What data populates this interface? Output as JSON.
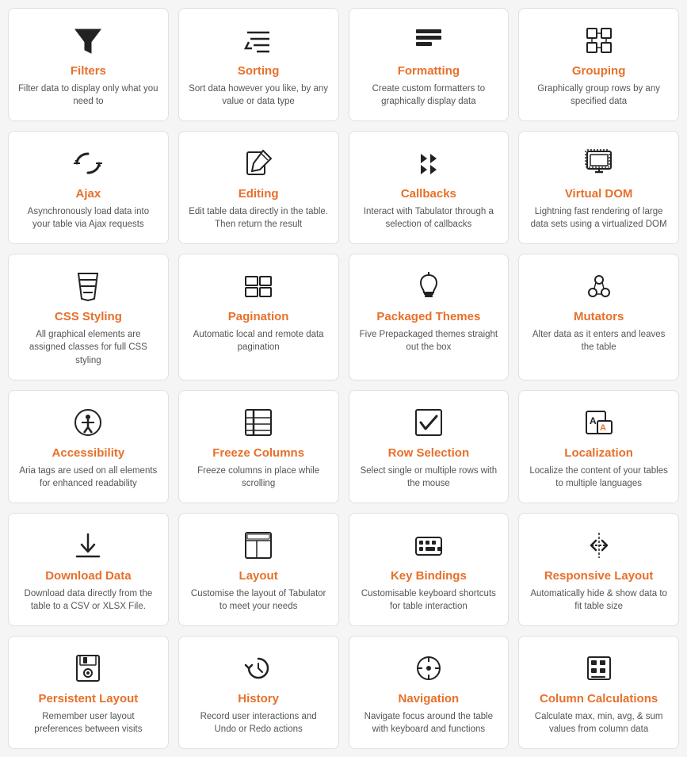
{
  "cards": [
    {
      "id": "filters",
      "icon": "filter",
      "title": "Filters",
      "desc": "Filter data to display only what you need to"
    },
    {
      "id": "sorting",
      "icon": "sort",
      "title": "Sorting",
      "desc": "Sort data however you like, by any value or data type"
    },
    {
      "id": "formatting",
      "icon": "formatting",
      "title": "Formatting",
      "desc": "Create custom formatters to graphically display data"
    },
    {
      "id": "grouping",
      "icon": "grouping",
      "title": "Grouping",
      "desc": "Graphically group rows by any specified data"
    },
    {
      "id": "ajax",
      "icon": "ajax",
      "title": "Ajax",
      "desc": "Asynchronously load data into your table via Ajax requests"
    },
    {
      "id": "editing",
      "icon": "editing",
      "title": "Editing",
      "desc": "Edit table data directly in the table. Then return the result"
    },
    {
      "id": "callbacks",
      "icon": "callbacks",
      "title": "Callbacks",
      "desc": "Interact with Tabulator through a selection of callbacks"
    },
    {
      "id": "virtual-dom",
      "icon": "virtual-dom",
      "title": "Virtual DOM",
      "desc": "Lightning fast rendering of large data sets using a virtualized DOM"
    },
    {
      "id": "css-styling",
      "icon": "css",
      "title": "CSS Styling",
      "desc": "All graphical elements are assigned classes for full CSS styling"
    },
    {
      "id": "pagination",
      "icon": "pagination",
      "title": "Pagination",
      "desc": "Automatic local and remote data pagination"
    },
    {
      "id": "packaged-themes",
      "icon": "themes",
      "title": "Packaged Themes",
      "desc": "Five Prepackaged themes straight out the box"
    },
    {
      "id": "mutators",
      "icon": "mutators",
      "title": "Mutators",
      "desc": "Alter data as it enters and leaves the table"
    },
    {
      "id": "accessibility",
      "icon": "accessibility",
      "title": "Accessibility",
      "desc": "Aria tags are used on all elements for enhanced readability"
    },
    {
      "id": "freeze-columns",
      "icon": "freeze",
      "title": "Freeze Columns",
      "desc": "Freeze columns in place while scrolling"
    },
    {
      "id": "row-selection",
      "icon": "row-selection",
      "title": "Row Selection",
      "desc": "Select single or multiple rows with the mouse"
    },
    {
      "id": "localization",
      "icon": "localization",
      "title": "Localization",
      "desc": "Localize the content of your tables to multiple languages"
    },
    {
      "id": "download-data",
      "icon": "download",
      "title": "Download Data",
      "desc": "Download data directly from the table to a CSV or XLSX File."
    },
    {
      "id": "layout",
      "icon": "layout",
      "title": "Layout",
      "desc": "Customise the layout of Tabulator to meet your needs"
    },
    {
      "id": "key-bindings",
      "icon": "key-bindings",
      "title": "Key Bindings",
      "desc": "Customisable keyboard shortcuts for table interaction"
    },
    {
      "id": "responsive-layout",
      "icon": "responsive",
      "title": "Responsive Layout",
      "desc": "Automatically hide & show data to fit table size"
    },
    {
      "id": "persistent-layout",
      "icon": "persistent",
      "title": "Persistent Layout",
      "desc": "Remember user layout preferences between visits"
    },
    {
      "id": "history",
      "icon": "history",
      "title": "History",
      "desc": "Record user interactions and Undo or Redo actions"
    },
    {
      "id": "navigation",
      "icon": "navigation",
      "title": "Navigation",
      "desc": "Navigate focus around the table with keyboard and functions"
    },
    {
      "id": "column-calculations",
      "icon": "calculations",
      "title": "Column Calculations",
      "desc": "Calculate max, min, avg, & sum values from column data"
    }
  ]
}
